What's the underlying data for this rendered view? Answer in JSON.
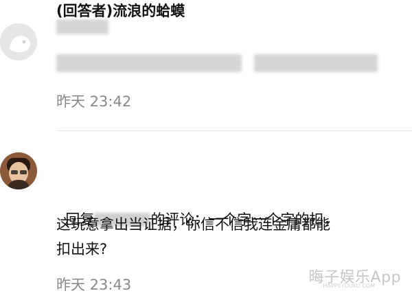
{
  "comments": [
    {
      "username_hidden": true,
      "time": "昨天 23:42"
    },
    {
      "username": "(回答者)流浪的蛤蟆",
      "reply_prefix": "回复",
      "reply_suffix": "的评论：一个字一个字的扣，",
      "line2": "这玩意拿出当证据，你信不信我连金庸都能",
      "line3": "扣出来?",
      "time": "昨天 23:43"
    }
  ],
  "watermark": {
    "brand": "晦子娱乐App",
    "sub": "HAPPY.YOUKU.COM"
  }
}
